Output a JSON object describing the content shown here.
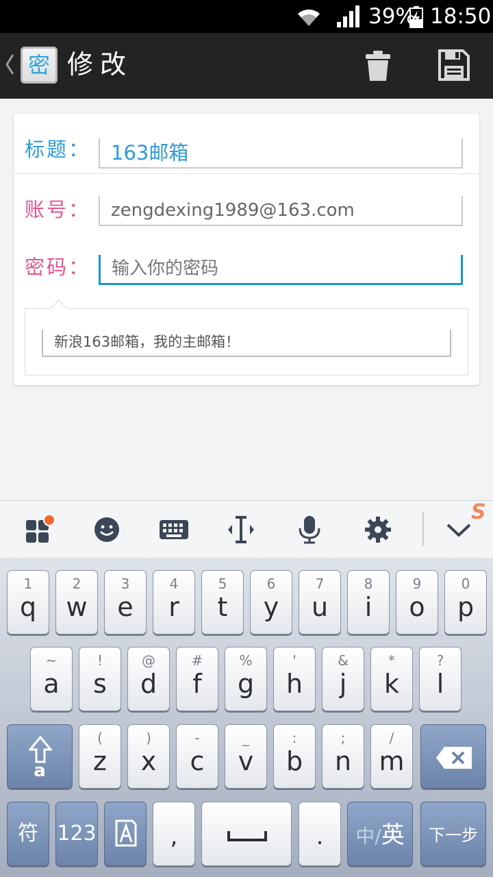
{
  "status_bar": {
    "battery": "39%",
    "time": "18:50"
  },
  "action_bar": {
    "app_icon_char": "密",
    "title": "修改"
  },
  "form": {
    "title_label": "标题：",
    "title_value": "163邮箱",
    "account_label": "账号：",
    "account_value": "zengdexing1989@163.com",
    "password_label": "密码：",
    "password_placeholder": "输入你的密码",
    "note_value": "新浪163邮箱，我的主邮箱！"
  },
  "colors": {
    "accent_blue": "#2f9bd6",
    "label_pink": "#e4568d",
    "focus_line": "#1398c9",
    "actionbar": "#232323"
  },
  "keyboard": {
    "toolbar_icons": [
      "apps-icon",
      "emoji-icon",
      "keyboard-icon",
      "cursor-icon",
      "microphone-icon",
      "settings-icon",
      "collapse-chevron-icon"
    ],
    "row1": [
      {
        "sub": "1",
        "main": "q"
      },
      {
        "sub": "2",
        "main": "w"
      },
      {
        "sub": "3",
        "main": "e"
      },
      {
        "sub": "4",
        "main": "r"
      },
      {
        "sub": "5",
        "main": "t"
      },
      {
        "sub": "6",
        "main": "y"
      },
      {
        "sub": "7",
        "main": "u"
      },
      {
        "sub": "8",
        "main": "i"
      },
      {
        "sub": "9",
        "main": "o"
      },
      {
        "sub": "0",
        "main": "p"
      }
    ],
    "row2": [
      {
        "sub": "~",
        "main": "a"
      },
      {
        "sub": "!",
        "main": "s"
      },
      {
        "sub": "@",
        "main": "d"
      },
      {
        "sub": "#",
        "main": "f"
      },
      {
        "sub": "%",
        "main": "g"
      },
      {
        "sub": "'",
        "main": "h"
      },
      {
        "sub": "&",
        "main": "j"
      },
      {
        "sub": "*",
        "main": "k"
      },
      {
        "sub": "?",
        "main": "l"
      }
    ],
    "row3": [
      {
        "sub": "(",
        "main": "z"
      },
      {
        "sub": ")",
        "main": "x"
      },
      {
        "sub": "-",
        "main": "c"
      },
      {
        "sub": "_",
        "main": "v"
      },
      {
        "sub": ":",
        "main": "b"
      },
      {
        "sub": ";",
        "main": "n"
      },
      {
        "sub": "/",
        "main": "m"
      }
    ],
    "shift_sub": "a",
    "symbol_key": "符",
    "number_key": "123",
    "comma_key": ",",
    "period_key": ".",
    "lang_key_inactive": "中/",
    "lang_key_active": "英",
    "next_key": "下一步"
  }
}
